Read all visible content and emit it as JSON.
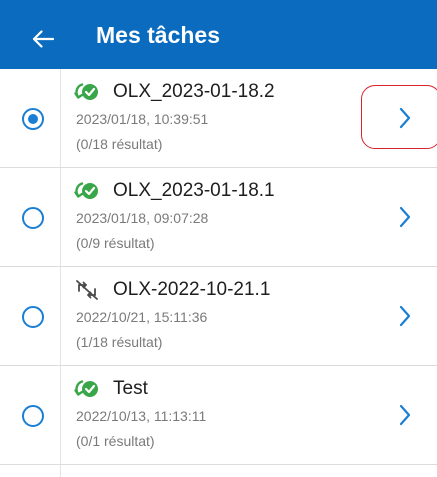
{
  "header": {
    "title": "Mes tâches",
    "back_icon": "arrow-left-icon"
  },
  "colors": {
    "header_bg": "#0a6bbf",
    "accent": "#1a7fd4",
    "sync_ok_green": "#3aa64a",
    "highlight_red": "#d9232d"
  },
  "tasks": [
    {
      "name": "OLX_2023-01-18.2",
      "date": "2023/01/18, 10:39:51",
      "result": "(0/18 résultat)",
      "status_icon": "sync-success-icon",
      "selected": true
    },
    {
      "name": "OLX_2023-01-18.1",
      "date": "2023/01/18, 09:07:28",
      "result": "(0/9 résultat)",
      "status_icon": "sync-success-icon",
      "selected": false
    },
    {
      "name": "OLX-2022-10-21.1",
      "date": "2022/10/21, 15:11:36",
      "result": "(1/18 résultat)",
      "status_icon": "sync-disabled-icon",
      "selected": false
    },
    {
      "name": "Test",
      "date": "2022/10/13, 11:13:11",
      "result": "(0/1 résultat)",
      "status_icon": "sync-success-icon",
      "selected": false
    }
  ]
}
